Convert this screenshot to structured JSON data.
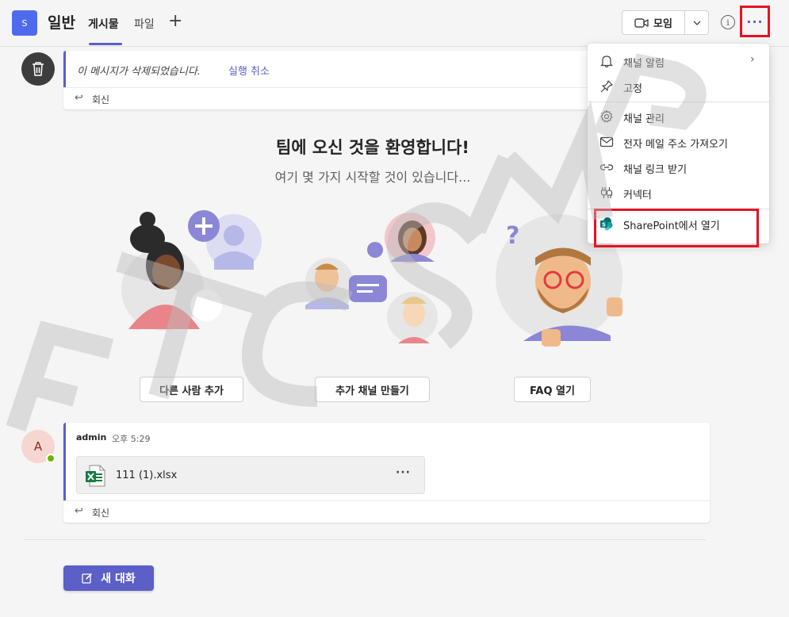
{
  "header": {
    "team_avatar": "S",
    "channel_name": "일반",
    "tabs": [
      {
        "label": "게시물",
        "active": true
      },
      {
        "label": "파일",
        "active": false
      }
    ],
    "add_tab_icon": "plus-icon",
    "meet_label": "모임",
    "info_icon": "info-icon",
    "more_icon": "more-options-icon"
  },
  "deleted_message": {
    "text": "이 메시지가 삭제되었습니다.",
    "undo_label": "실행 취소",
    "reply_label": "회신"
  },
  "welcome": {
    "title": "팀에 오신 것을 환영합니다!",
    "subtitle": "여기 몇 가지 시작할 것이 있습니다...",
    "buttons": [
      "다른 사람 추가",
      "추가 채널 만들기",
      "FAQ 열기"
    ]
  },
  "message": {
    "avatar": "A",
    "author": "admin",
    "time": "오후 5:29",
    "file_name": "111 (1).xlsx",
    "file_more": "···",
    "reply_label": "회신"
  },
  "new_conversation_label": "새 대화",
  "menu": {
    "items": [
      {
        "label": "채널 알림",
        "icon": "bell-icon",
        "submenu": true
      },
      {
        "label": "고정",
        "icon": "pin-icon"
      },
      {
        "label": "채널 관리",
        "icon": "gear-icon"
      },
      {
        "label": "전자 메일 주소 가져오기",
        "icon": "mail-icon"
      },
      {
        "label": "채널 링크 받기",
        "icon": "link-icon"
      },
      {
        "label": "커넥터",
        "icon": "connector-icon"
      },
      {
        "label": "SharePoint에서 열기",
        "icon": "sharepoint-icon"
      }
    ]
  },
  "colors": {
    "accent": "#5b5fc7",
    "highlight_box": "#e81123",
    "team_avatar": "#4f6bed",
    "excel": "#107c41"
  }
}
